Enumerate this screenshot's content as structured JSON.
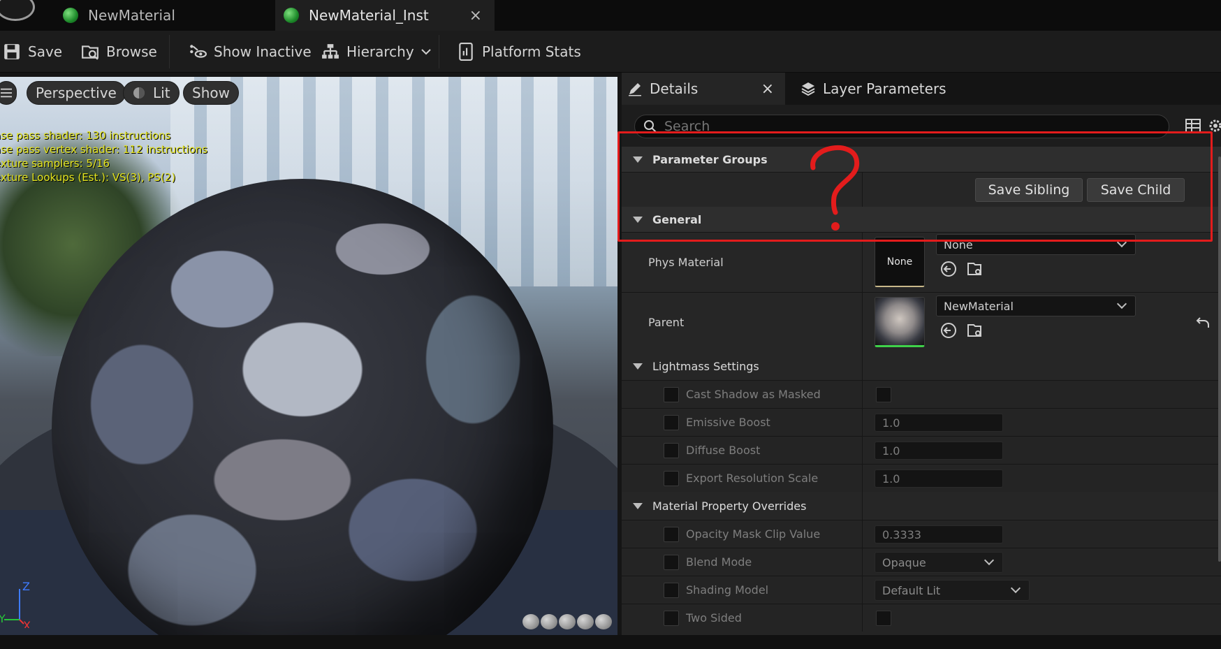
{
  "tabs": [
    {
      "label": "NewMaterial"
    },
    {
      "label": "NewMaterial_Inst"
    }
  ],
  "toolbar": {
    "save": "Save",
    "browse": "Browse",
    "show_inactive": "Show Inactive",
    "hierarchy": "Hierarchy",
    "platform_stats": "Platform Stats"
  },
  "viewport": {
    "perspective": "Perspective",
    "lit": "Lit",
    "show": "Show",
    "stats": [
      "ase pass shader: 130 instructions",
      "ase pass vertex shader: 112 instructions",
      "exture samplers: 5/16",
      "exture Lookups (Est.): VS(3), PS(2)"
    ],
    "axis": {
      "z": "Z",
      "y": "Y",
      "x": "X"
    }
  },
  "details": {
    "tab_details": "Details",
    "tab_layer_params": "Layer Parameters",
    "search_placeholder": "Search",
    "parameter_groups": "Parameter Groups",
    "save_sibling": "Save Sibling",
    "save_child": "Save Child",
    "general": "General",
    "phys_material": {
      "label": "Phys Material",
      "thumb": "None",
      "value": "None"
    },
    "parent": {
      "label": "Parent",
      "value": "NewMaterial"
    },
    "lightmass": {
      "title": "Lightmass Settings",
      "cast_shadow": "Cast Shadow as Masked",
      "emissive_boost": {
        "label": "Emissive Boost",
        "value": "1.0"
      },
      "diffuse_boost": {
        "label": "Diffuse Boost",
        "value": "1.0"
      },
      "export_res": {
        "label": "Export Resolution Scale",
        "value": "1.0"
      }
    },
    "overrides": {
      "title": "Material Property Overrides",
      "opacity_mask": {
        "label": "Opacity Mask Clip Value",
        "value": "0.3333"
      },
      "blend_mode": {
        "label": "Blend Mode",
        "value": "Opaque"
      },
      "shading_model": {
        "label": "Shading Model",
        "value": "Default Lit"
      },
      "two_sided": {
        "label": "Two Sided"
      }
    }
  },
  "annotation": {
    "symbol": "?",
    "color": "#e31c1c"
  }
}
